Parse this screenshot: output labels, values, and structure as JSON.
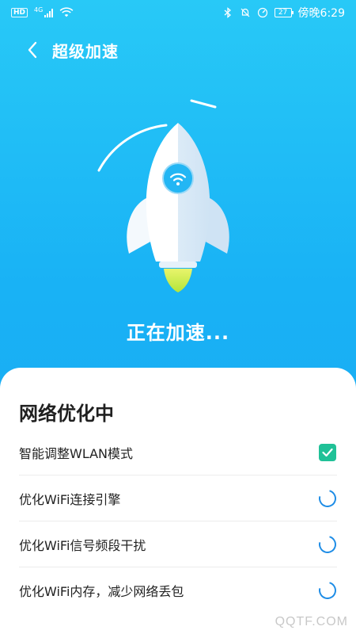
{
  "status_bar": {
    "hd_badge": "HD",
    "network": "4G",
    "battery": "27",
    "time": "傍晚6:29"
  },
  "header": {
    "back_icon": "chevron-left-icon",
    "title": "超级加速"
  },
  "hero": {
    "rocket_icon": "rocket-icon",
    "wifi_icon": "wifi-icon",
    "status": "正在加速..."
  },
  "sheet": {
    "title": "网络优化中",
    "tasks": [
      {
        "label": "智能调整WLAN模式",
        "state": "done"
      },
      {
        "label": "优化WiFi连接引擎",
        "state": "loading"
      },
      {
        "label": "优化WiFi信号频段干扰",
        "state": "loading"
      },
      {
        "label": "优化WiFi内存，减少网络丢包",
        "state": "loading"
      }
    ]
  },
  "watermark": "QQTF.COM",
  "colors": {
    "background": "#1ab0f5",
    "check": "#20c197",
    "spinner": "#1f8de6"
  }
}
